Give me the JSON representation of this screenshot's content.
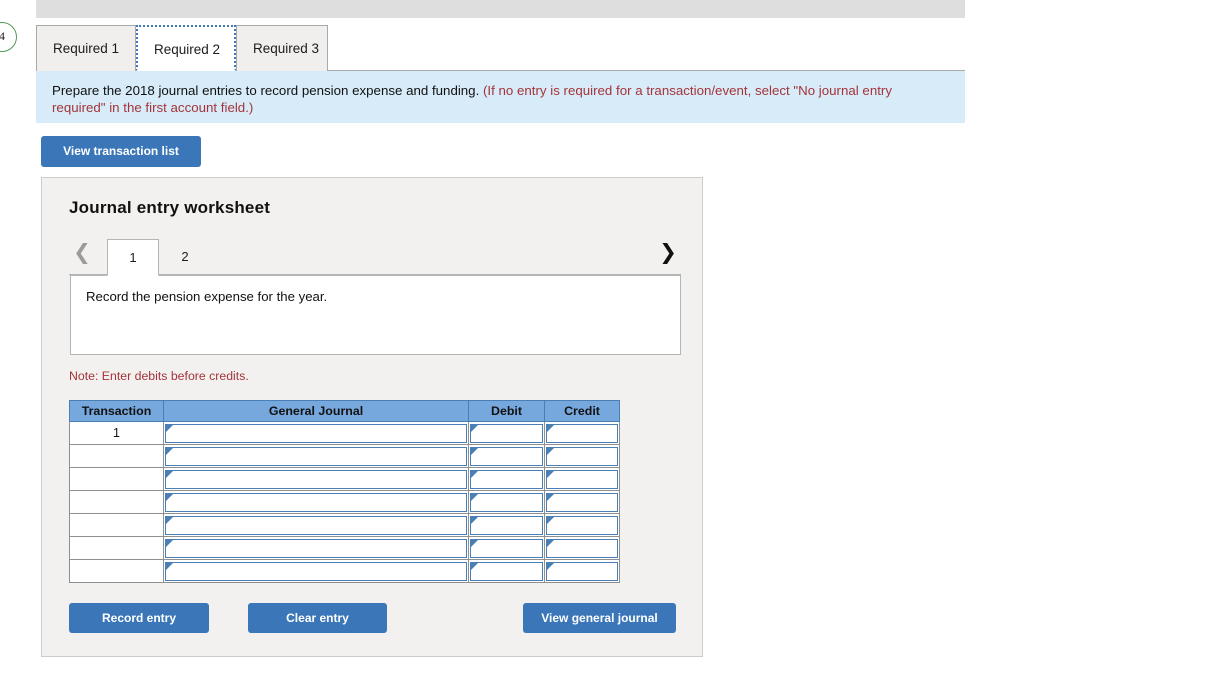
{
  "badge": {
    "number": "4"
  },
  "required_tabs": {
    "items": [
      {
        "label": "Required 1",
        "active": false
      },
      {
        "label": "Required 2",
        "active": true
      },
      {
        "label": "Required 3",
        "active": false
      }
    ]
  },
  "instruction": {
    "main": "Prepare the 2018 journal entries to record pension expense and funding.",
    "hint": "(If no entry is required for a transaction/event, select \"No journal entry required\" in the first account field.)"
  },
  "toolbar": {
    "view_transaction_list": "View transaction list"
  },
  "worksheet": {
    "title": "Journal entry worksheet",
    "pager": {
      "prev_icon": "chevron-left-icon",
      "next_icon": "chevron-right-icon",
      "tabs": [
        {
          "label": "1",
          "active": true
        },
        {
          "label": "2",
          "active": false
        }
      ]
    },
    "description": "Record the pension expense for the year.",
    "note": "Note: Enter debits before credits.",
    "table": {
      "headers": [
        "Transaction",
        "General Journal",
        "Debit",
        "Credit"
      ],
      "rows": [
        {
          "transaction": "1",
          "general_journal": "",
          "debit": "",
          "credit": ""
        },
        {
          "transaction": "",
          "general_journal": "",
          "debit": "",
          "credit": ""
        },
        {
          "transaction": "",
          "general_journal": "",
          "debit": "",
          "credit": ""
        },
        {
          "transaction": "",
          "general_journal": "",
          "debit": "",
          "credit": ""
        },
        {
          "transaction": "",
          "general_journal": "",
          "debit": "",
          "credit": ""
        },
        {
          "transaction": "",
          "general_journal": "",
          "debit": "",
          "credit": ""
        },
        {
          "transaction": "",
          "general_journal": "",
          "debit": "",
          "credit": ""
        }
      ]
    },
    "actions": {
      "record_entry": "Record entry",
      "clear_entry": "Clear entry",
      "view_general_journal": "View general journal"
    }
  },
  "colors": {
    "button_blue": "#3a76b8",
    "table_header_blue": "#77a8dd",
    "input_border_blue": "#4a7fb5",
    "banner_blue": "#d7ebf9",
    "note_red": "#a4343a",
    "panel_gray": "#f2f1f0",
    "badge_green": "#4f9b56"
  }
}
